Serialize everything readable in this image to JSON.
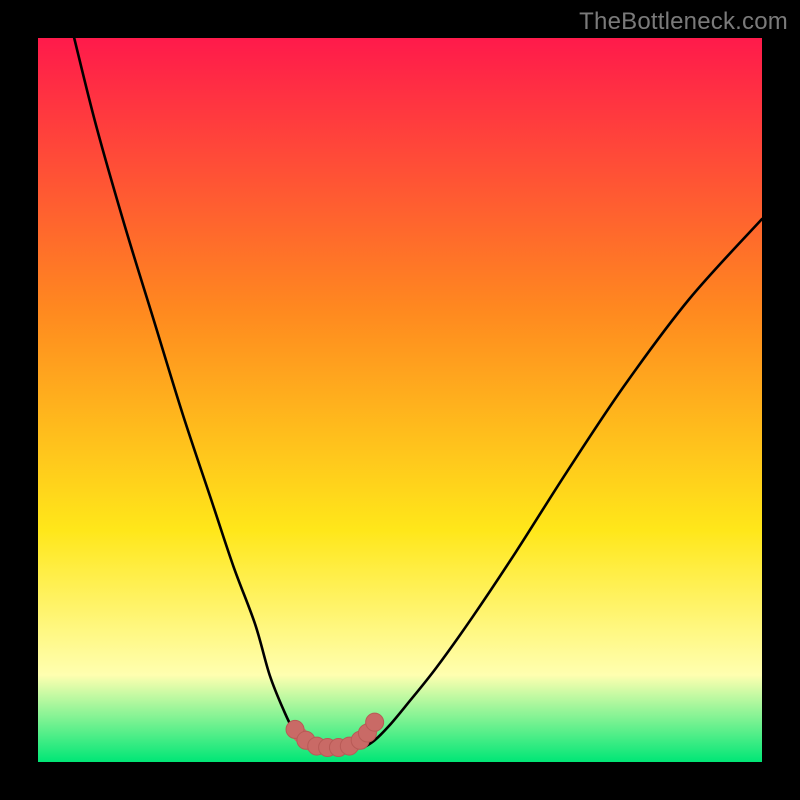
{
  "watermark": "TheBottleneck.com",
  "colors": {
    "frame": "#000000",
    "gradient_top": "#ff1a4b",
    "gradient_mid1": "#ff8a1f",
    "gradient_mid2": "#ffe71a",
    "gradient_mid3": "#ffffb0",
    "gradient_bottom": "#00e676",
    "curve": "#000000",
    "marker_fill": "#c96a66",
    "marker_stroke": "#b85a56"
  },
  "chart_data": {
    "type": "line",
    "title": "",
    "xlabel": "",
    "ylabel": "",
    "xlim": [
      0,
      100
    ],
    "ylim": [
      0,
      100
    ],
    "series": [
      {
        "name": "left-branch",
        "x": [
          5,
          8,
          12,
          16,
          20,
          24,
          27,
          30,
          32,
          34,
          35.5,
          36.5,
          37.5
        ],
        "y": [
          100,
          88,
          74,
          61,
          48,
          36,
          27,
          19,
          12,
          7,
          4,
          3,
          2
        ]
      },
      {
        "name": "right-branch",
        "x": [
          45,
          46.5,
          48.5,
          51,
          55,
          60,
          66,
          73,
          81,
          90,
          100
        ],
        "y": [
          2,
          3,
          5,
          8,
          13,
          20,
          29,
          40,
          52,
          64,
          75
        ]
      },
      {
        "name": "bottom-markers",
        "x": [
          35.5,
          37,
          38.5,
          40,
          41.5,
          43,
          44.5,
          45.5,
          46.5
        ],
        "y": [
          4.5,
          3,
          2.2,
          2,
          2,
          2.2,
          3,
          4,
          5.5
        ]
      }
    ]
  }
}
